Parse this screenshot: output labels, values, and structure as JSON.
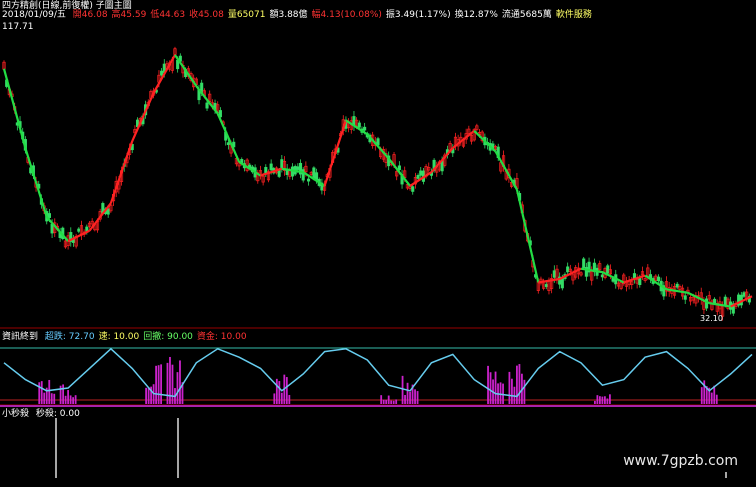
{
  "header": {
    "title": "四方精創(日線,前復權) 子圖主圖",
    "date": "2018/01/09/五",
    "quote": [
      {
        "text": "開46.08",
        "color": "#ff3333"
      },
      {
        "text": "高45.59",
        "color": "#ff3333"
      },
      {
        "text": "低44.63",
        "color": "#ff3333"
      },
      {
        "text": "收45.08",
        "color": "#ff3333"
      },
      {
        "text": "量65071",
        "color": "#ffff66"
      },
      {
        "text": "額3.88億",
        "color": "#ffffff"
      },
      {
        "text": "幅4.13(10.08%)",
        "color": "#ff3333"
      },
      {
        "text": "振3.49(1.17%)",
        "color": "#ffffff"
      },
      {
        "text": "換12.87%",
        "color": "#ffffff"
      },
      {
        "text": "流通5685萬",
        "color": "#ffffff"
      },
      {
        "text": "軟件服務",
        "color": "#ffff66"
      }
    ],
    "price_high": "117.71",
    "price_low": "32.10"
  },
  "indicator1": {
    "title": "資訊終到",
    "items": [
      {
        "text": "超跌: 72.70",
        "color": "#66ccff"
      },
      {
        "text": "速: 10.00",
        "color": "#ffff66"
      },
      {
        "text": "回撤: 90.00",
        "color": "#66ff66"
      },
      {
        "text": "資金: 10.00",
        "color": "#ff3333"
      }
    ]
  },
  "indicator2": {
    "title": "小秒殺",
    "value": "秒殺: 0.00"
  },
  "watermark": "www.7gpzb.com",
  "colors": {
    "up": "#ff2222",
    "down": "#33dd66",
    "ma_up": "#ff2222",
    "ma_down": "#22dd44",
    "osc": "#66ccee",
    "bars": "#cc22cc",
    "line_top": "#33bbaa",
    "line_bottom": "#aa22aa"
  },
  "chart_data": [
    {
      "type": "line",
      "title": "",
      "series": [
        {
          "values": [
            105,
            82,
            62,
            55,
            58,
            66,
            84,
            98,
            109,
            100,
            92,
            78,
            74,
            76,
            75,
            71,
            90,
            86,
            79,
            71,
            75,
            82,
            87,
            81,
            70,
            43,
            44,
            47,
            46,
            43,
            45,
            41,
            40,
            37,
            36,
            39
          ]
        }
      ],
      "ylim": [
        32.1,
        117.71
      ]
    },
    {
      "type": "line",
      "title": "",
      "series": [
        {
          "values": [
            70,
            40,
            20,
            25,
            60,
            95,
            60,
            15,
            10,
            70,
            95,
            80,
            60,
            20,
            50,
            90,
            95,
            75,
            30,
            20,
            70,
            85,
            40,
            15,
            10,
            60,
            90,
            70,
            30,
            40,
            80,
            90,
            60,
            20,
            50,
            85
          ]
        }
      ],
      "ylim": [
        0,
        100
      ]
    },
    {
      "type": "bar",
      "title": "",
      "values": [
        1,
        1,
        0.1
      ],
      "ylim": [
        0,
        1
      ]
    }
  ]
}
